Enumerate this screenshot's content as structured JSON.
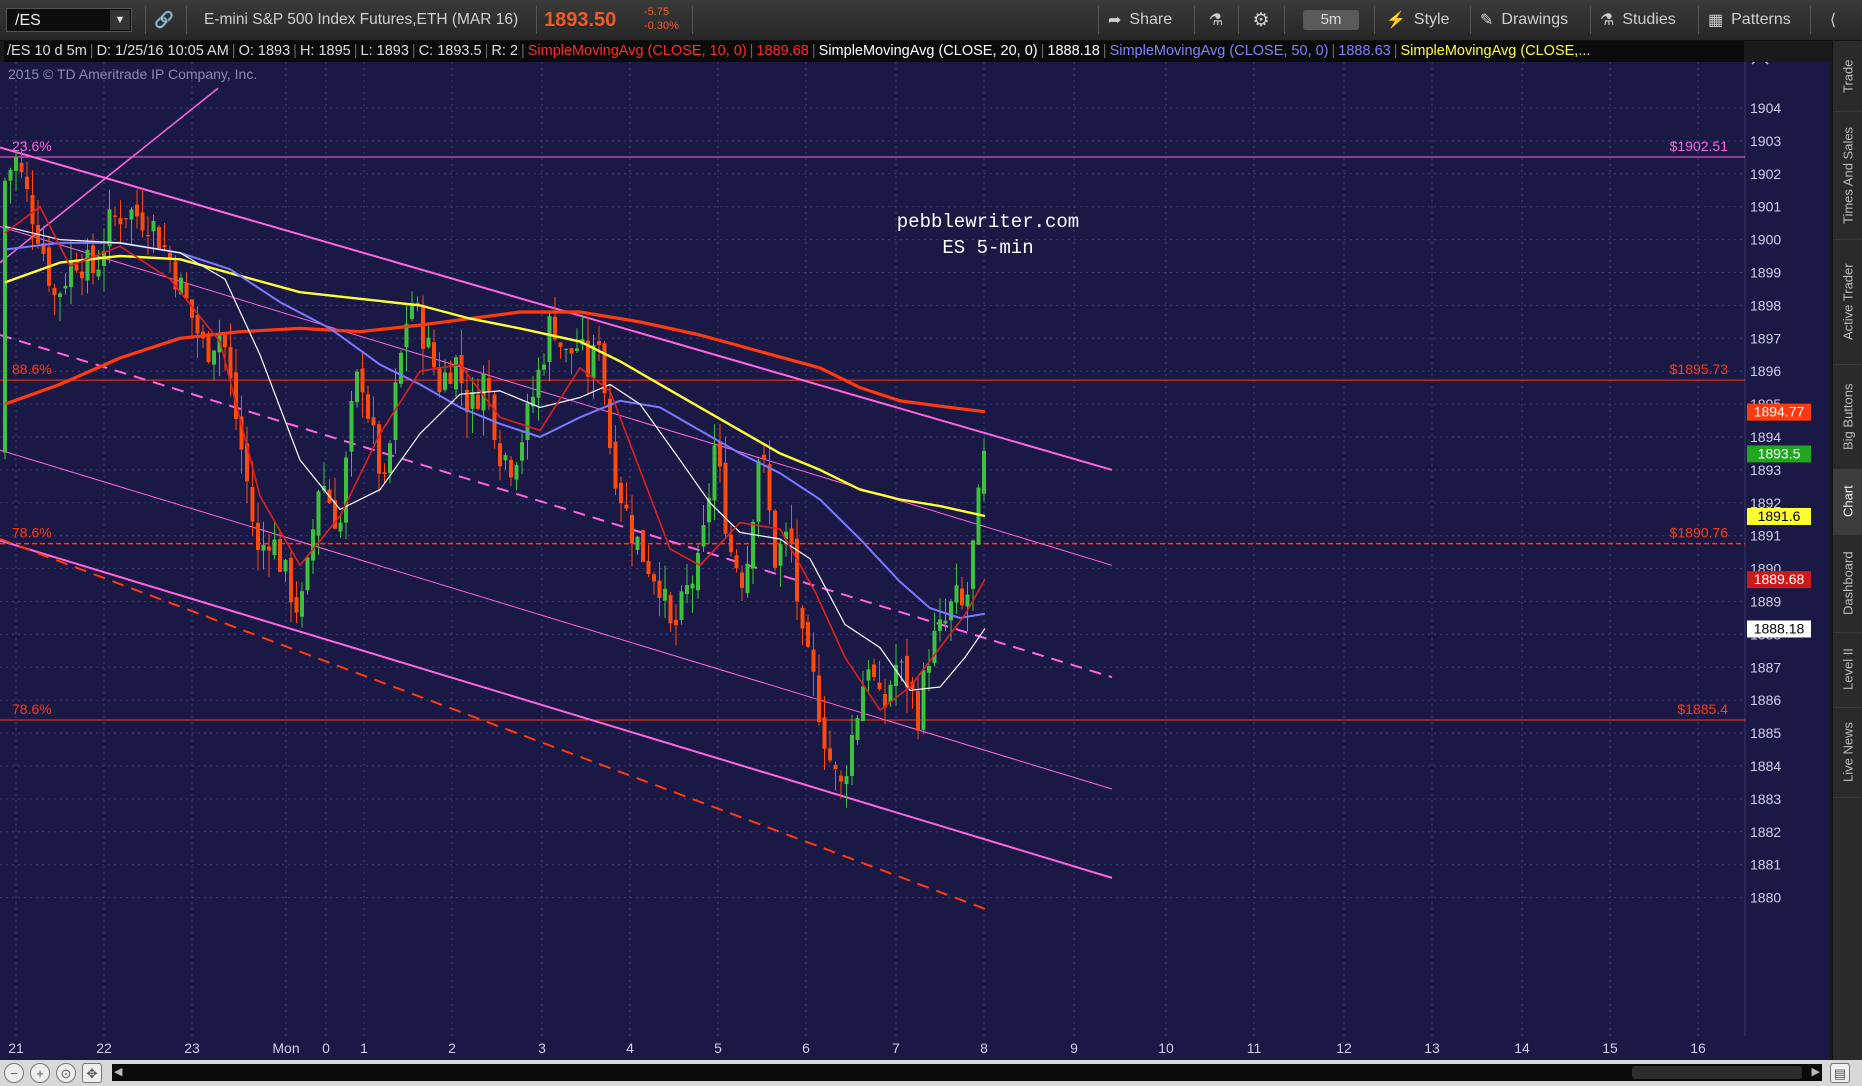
{
  "toolbar": {
    "symbol": "/ES",
    "description": "E-mini S&P 500 Index Futures,ETH (MAR 16)",
    "last_price": "1893.50",
    "net_change": "-5.75",
    "pct_change": "-0.30%",
    "share_label": "Share",
    "timeframe": "5m",
    "style_label": "Style",
    "drawings_label": "Drawings",
    "studies_label": "Studies",
    "patterns_label": "Patterns"
  },
  "infobar": {
    "symbol_period": "/ES 10 d 5m",
    "date": "D: 1/25/16 10:05 AM",
    "open": "O: 1893",
    "high": "H: 1895",
    "low": "L: 1893",
    "close": "C: 1893.5",
    "range": "R: 2",
    "sma10_label": "SimpleMovingAvg (CLOSE, 10, 0)",
    "sma10_value": "1889.68",
    "sma20_label": "SimpleMovingAvg (CLOSE, 20, 0)",
    "sma20_value": "1888.18",
    "sma50_label": "SimpleMovingAvg (CLOSE, 50, 0)",
    "sma50_value": "1888.63",
    "sma_more_label": "SimpleMovingAvg (CLOSE,..."
  },
  "colors": {
    "background": "#1a1845",
    "up": "#3cc13c",
    "down": "#ff4a0a",
    "sma10": "#e02020",
    "sma20": "#ffffff",
    "sma50": "#7a7aff",
    "sma100": "#ffff33",
    "sma200": "#ff3a10",
    "channel": "#ff66dd",
    "fib": "#ff3a10"
  },
  "sidetabs": [
    "Trade",
    "Times And Sales",
    "Active Trader",
    "Big Buttons",
    "Chart",
    "Dashboard",
    "Level II",
    "Live News"
  ],
  "sidetab_active": "Chart",
  "chart_data": {
    "type": "candlestick",
    "copyright": "2015 © TD Ameritrade IP Company, Inc.",
    "annotation": [
      "pebblewriter.com",
      "ES 5-min"
    ],
    "ylim": [
      1879.5,
      1904.5
    ],
    "yticks": [
      1880,
      1881,
      1882,
      1883,
      1884,
      1885,
      1886,
      1887,
      1888,
      1889,
      1890,
      1891,
      1892,
      1893,
      1894,
      1895,
      1896,
      1897,
      1898,
      1899,
      1900,
      1901,
      1902,
      1903,
      1904
    ],
    "xticks": [
      "21",
      "22",
      "23",
      "Mon",
      "0",
      "1",
      "2",
      "3",
      "4",
      "5",
      "6",
      "7",
      "8",
      "9",
      "10",
      "11",
      "12",
      "13",
      "14",
      "15",
      "16"
    ],
    "grid": true,
    "price_badges": [
      {
        "value": 1894.77,
        "label": "1894.77",
        "bg": "#ff3a10",
        "fg": "#ffffff"
      },
      {
        "value": 1893.5,
        "label": "1893.5",
        "bg": "#1fa81f",
        "fg": "#ffffff"
      },
      {
        "value": 1891.6,
        "label": "1891.6",
        "bg": "#ffff33",
        "fg": "#000000"
      },
      {
        "value": 1889.68,
        "label": "1889.68",
        "bg": "#cc1a1a",
        "fg": "#ffffff"
      },
      {
        "value": 1888.18,
        "label": "1888.18",
        "bg": "#ffffff",
        "fg": "#000000"
      }
    ],
    "fib_levels": [
      {
        "pct": "23.6%",
        "price": 1902.51,
        "label": "$1902.51",
        "color": "#ff66dd"
      },
      {
        "pct": "88.6%",
        "price": 1895.73,
        "label": "$1895.73",
        "color": "#ff3a10"
      },
      {
        "pct": "78.6%",
        "price": 1890.76,
        "label": "$1890.76",
        "color": "#ff3a10"
      },
      {
        "pct": "78.6%",
        "price": 1885.4,
        "label": "$1885.4",
        "color": "#ff3a10"
      }
    ],
    "channel_lines": [
      {
        "from": [
          0,
          1902.8
        ],
        "to": [
          1112,
          1893.0
        ],
        "style": "solid",
        "width": 2,
        "color": "#ff66dd"
      },
      {
        "from": [
          0,
          1900.4
        ],
        "to": [
          1112,
          1890.1
        ],
        "style": "solid",
        "width": 1,
        "color": "#ff66dd"
      },
      {
        "from": [
          0,
          1897.1
        ],
        "to": [
          1112,
          1886.7
        ],
        "style": "dashed",
        "width": 2,
        "color": "#ff66dd"
      },
      {
        "from": [
          0,
          1893.6
        ],
        "to": [
          1112,
          1883.3
        ],
        "style": "solid",
        "width": 1,
        "color": "#ff66dd"
      },
      {
        "from": [
          0,
          1890.85
        ],
        "to": [
          1112,
          1880.6
        ],
        "style": "solid",
        "width": 2,
        "color": "#ff66dd"
      },
      {
        "from": [
          0,
          1890.9
        ],
        "to": [
          990,
          1879.6
        ],
        "style": "dashed",
        "width": 2,
        "color": "#ff3a10"
      },
      {
        "from": [
          0,
          1899.3
        ],
        "to": [
          218,
          1904.6
        ],
        "style": "solid",
        "width": 1.5,
        "color": "#ff66dd"
      }
    ],
    "ohlc_anchors": [
      {
        "x": 5,
        "c": 1901.8
      },
      {
        "x": 15,
        "c": 1902.5
      },
      {
        "x": 40,
        "c": 1900.1
      },
      {
        "x": 55,
        "c": 1898.2
      },
      {
        "x": 75,
        "c": 1899.5
      },
      {
        "x": 95,
        "c": 1899.0
      },
      {
        "x": 110,
        "c": 1900.5
      },
      {
        "x": 125,
        "c": 1900.9
      },
      {
        "x": 150,
        "c": 1900.6
      },
      {
        "x": 170,
        "c": 1899.4
      },
      {
        "x": 190,
        "c": 1897.8
      },
      {
        "x": 205,
        "c": 1896.6
      },
      {
        "x": 222,
        "c": 1897.3
      },
      {
        "x": 232,
        "c": 1895.3
      },
      {
        "x": 245,
        "c": 1893.0
      },
      {
        "x": 258,
        "c": 1890.4
      },
      {
        "x": 270,
        "c": 1891.1
      },
      {
        "x": 285,
        "c": 1889.8
      },
      {
        "x": 300,
        "c": 1888.6
      },
      {
        "x": 308,
        "c": 1890.0
      },
      {
        "x": 320,
        "c": 1892.9
      },
      {
        "x": 340,
        "c": 1891.2
      },
      {
        "x": 350,
        "c": 1894.4
      },
      {
        "x": 360,
        "c": 1896.2
      },
      {
        "x": 372,
        "c": 1894.1
      },
      {
        "x": 385,
        "c": 1892.3
      },
      {
        "x": 395,
        "c": 1895.2
      },
      {
        "x": 410,
        "c": 1898.3
      },
      {
        "x": 425,
        "c": 1897.0
      },
      {
        "x": 440,
        "c": 1895.6
      },
      {
        "x": 455,
        "c": 1896.4
      },
      {
        "x": 470,
        "c": 1894.8
      },
      {
        "x": 485,
        "c": 1895.9
      },
      {
        "x": 500,
        "c": 1893.6
      },
      {
        "x": 512,
        "c": 1893.2
      },
      {
        "x": 525,
        "c": 1894.3
      },
      {
        "x": 540,
        "c": 1896.1
      },
      {
        "x": 552,
        "c": 1897.7
      },
      {
        "x": 565,
        "c": 1896.4
      },
      {
        "x": 578,
        "c": 1896.8
      },
      {
        "x": 590,
        "c": 1895.9
      },
      {
        "x": 600,
        "c": 1897.3
      },
      {
        "x": 608,
        "c": 1894.1
      },
      {
        "x": 618,
        "c": 1892.6
      },
      {
        "x": 630,
        "c": 1891.3
      },
      {
        "x": 645,
        "c": 1890.3
      },
      {
        "x": 660,
        "c": 1889.6
      },
      {
        "x": 672,
        "c": 1887.9
      },
      {
        "x": 688,
        "c": 1889.4
      },
      {
        "x": 700,
        "c": 1890.1
      },
      {
        "x": 715,
        "c": 1893.8
      },
      {
        "x": 730,
        "c": 1890.6
      },
      {
        "x": 745,
        "c": 1889.6
      },
      {
        "x": 760,
        "c": 1893.9
      },
      {
        "x": 775,
        "c": 1890.3
      },
      {
        "x": 790,
        "c": 1891.1
      },
      {
        "x": 802,
        "c": 1887.7
      },
      {
        "x": 815,
        "c": 1886.4
      },
      {
        "x": 828,
        "c": 1884.4
      },
      {
        "x": 840,
        "c": 1883.2
      },
      {
        "x": 855,
        "c": 1885.3
      },
      {
        "x": 868,
        "c": 1887.3
      },
      {
        "x": 882,
        "c": 1885.5
      },
      {
        "x": 895,
        "c": 1887.1
      },
      {
        "x": 908,
        "c": 1886.6
      },
      {
        "x": 918,
        "c": 1885.6
      },
      {
        "x": 930,
        "c": 1887.6
      },
      {
        "x": 945,
        "c": 1888.3
      },
      {
        "x": 955,
        "c": 1889.1
      },
      {
        "x": 965,
        "c": 1888.6
      },
      {
        "x": 975,
        "c": 1891.1
      },
      {
        "x": 985,
        "c": 1893.5
      }
    ],
    "sma10_anchors": [
      [
        5,
        1900.2
      ],
      [
        40,
        1901.0
      ],
      [
        70,
        1899.2
      ],
      [
        120,
        1899.8
      ],
      [
        170,
        1898.8
      ],
      [
        220,
        1896.9
      ],
      [
        260,
        1892.2
      ],
      [
        300,
        1890.1
      ],
      [
        340,
        1891.6
      ],
      [
        380,
        1894.1
      ],
      [
        420,
        1896.0
      ],
      [
        460,
        1896.2
      ],
      [
        500,
        1894.6
      ],
      [
        540,
        1894.2
      ],
      [
        580,
        1896.1
      ],
      [
        610,
        1895.4
      ],
      [
        640,
        1893.0
      ],
      [
        670,
        1890.6
      ],
      [
        700,
        1890.1
      ],
      [
        740,
        1891.4
      ],
      [
        780,
        1891.2
      ],
      [
        815,
        1889.3
      ],
      [
        845,
        1887.3
      ],
      [
        880,
        1885.7
      ],
      [
        910,
        1886.4
      ],
      [
        940,
        1887.6
      ],
      [
        965,
        1888.6
      ],
      [
        985,
        1889.68
      ]
    ],
    "sma20_anchors": [
      [
        5,
        1900.4
      ],
      [
        60,
        1900.0
      ],
      [
        120,
        1899.9
      ],
      [
        180,
        1899.6
      ],
      [
        225,
        1898.8
      ],
      [
        260,
        1896.5
      ],
      [
        300,
        1893.3
      ],
      [
        340,
        1891.8
      ],
      [
        380,
        1892.4
      ],
      [
        420,
        1894.1
      ],
      [
        460,
        1895.3
      ],
      [
        500,
        1895.4
      ],
      [
        540,
        1894.9
      ],
      [
        580,
        1895.2
      ],
      [
        610,
        1895.6
      ],
      [
        640,
        1895.0
      ],
      [
        680,
        1893.3
      ],
      [
        710,
        1892.0
      ],
      [
        740,
        1891.1
      ],
      [
        780,
        1890.9
      ],
      [
        810,
        1890.3
      ],
      [
        845,
        1888.3
      ],
      [
        880,
        1887.6
      ],
      [
        910,
        1886.3
      ],
      [
        940,
        1886.4
      ],
      [
        965,
        1887.3
      ],
      [
        985,
        1888.18
      ]
    ],
    "sma50_anchors": [
      [
        5,
        1899.7
      ],
      [
        60,
        1899.9
      ],
      [
        120,
        1899.9
      ],
      [
        180,
        1899.6
      ],
      [
        230,
        1899.1
      ],
      [
        280,
        1898.1
      ],
      [
        330,
        1897.3
      ],
      [
        380,
        1896.2
      ],
      [
        420,
        1895.6
      ],
      [
        460,
        1894.9
      ],
      [
        500,
        1894.4
      ],
      [
        540,
        1894.0
      ],
      [
        580,
        1894.6
      ],
      [
        620,
        1895.1
      ],
      [
        660,
        1894.9
      ],
      [
        700,
        1894.2
      ],
      [
        740,
        1893.5
      ],
      [
        780,
        1892.9
      ],
      [
        820,
        1892.1
      ],
      [
        860,
        1890.9
      ],
      [
        900,
        1889.6
      ],
      [
        930,
        1888.8
      ],
      [
        960,
        1888.5
      ],
      [
        985,
        1888.63
      ]
    ],
    "sma100_anchors": [
      [
        5,
        1898.7
      ],
      [
        60,
        1899.3
      ],
      [
        120,
        1899.5
      ],
      [
        180,
        1899.4
      ],
      [
        240,
        1898.9
      ],
      [
        300,
        1898.4
      ],
      [
        360,
        1898.2
      ],
      [
        420,
        1898.0
      ],
      [
        470,
        1897.6
      ],
      [
        520,
        1897.3
      ],
      [
        580,
        1896.9
      ],
      [
        620,
        1896.3
      ],
      [
        660,
        1895.6
      ],
      [
        700,
        1894.9
      ],
      [
        740,
        1894.2
      ],
      [
        780,
        1893.5
      ],
      [
        820,
        1893.0
      ],
      [
        860,
        1892.4
      ],
      [
        900,
        1892.1
      ],
      [
        940,
        1891.9
      ],
      [
        985,
        1891.6
      ]
    ],
    "sma200_anchors": [
      [
        5,
        1895.0
      ],
      [
        60,
        1895.6
      ],
      [
        120,
        1896.4
      ],
      [
        180,
        1897.0
      ],
      [
        240,
        1897.2
      ],
      [
        300,
        1897.3
      ],
      [
        360,
        1897.2
      ],
      [
        420,
        1897.4
      ],
      [
        470,
        1897.6
      ],
      [
        520,
        1897.8
      ],
      [
        580,
        1897.8
      ],
      [
        640,
        1897.5
      ],
      [
        700,
        1897.1
      ],
      [
        760,
        1896.6
      ],
      [
        820,
        1896.1
      ],
      [
        860,
        1895.5
      ],
      [
        900,
        1895.1
      ],
      [
        950,
        1894.9
      ],
      [
        985,
        1894.77
      ]
    ]
  }
}
